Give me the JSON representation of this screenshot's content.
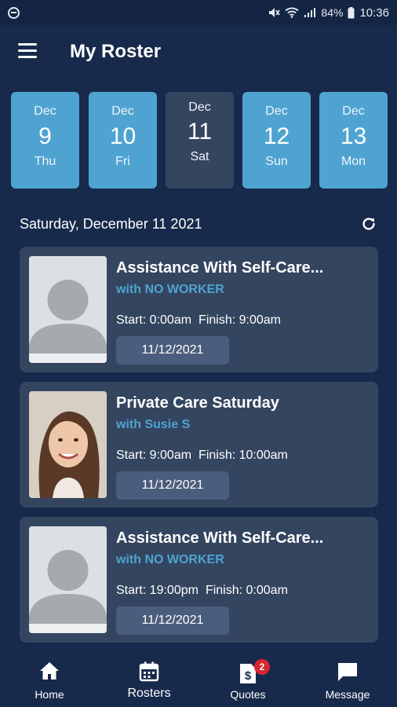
{
  "status_bar": {
    "battery": "84%",
    "time": "10:36"
  },
  "app_bar": {
    "title": "My Roster"
  },
  "dates": [
    {
      "month": "Dec",
      "day": "9",
      "weekday": "Thu",
      "selected": false
    },
    {
      "month": "Dec",
      "day": "10",
      "weekday": "Fri",
      "selected": false
    },
    {
      "month": "Dec",
      "day": "11",
      "weekday": "Sat",
      "selected": true
    },
    {
      "month": "Dec",
      "day": "12",
      "weekday": "Sun",
      "selected": false
    },
    {
      "month": "Dec",
      "day": "13",
      "weekday": "Mon",
      "selected": false
    }
  ],
  "section": {
    "date_heading": "Saturday, December 11 2021"
  },
  "shifts": [
    {
      "title": "Assistance With Self-Care...",
      "worker": "with NO WORKER",
      "start": "Start: 0:00am",
      "finish": "Finish: 9:00am",
      "date": "11/12/2021",
      "avatar": "placeholder"
    },
    {
      "title": "Private Care Saturday",
      "worker": "with Susie S",
      "start": "Start: 9:00am",
      "finish": "Finish: 10:00am",
      "date": "11/12/2021",
      "avatar": "photo"
    },
    {
      "title": "Assistance With Self-Care...",
      "worker": "with NO WORKER",
      "start": "Start: 19:00pm",
      "finish": "Finish: 0:00am",
      "date": "11/12/2021",
      "avatar": "placeholder"
    }
  ],
  "bottom_nav": {
    "home": "Home",
    "rosters": "Rosters",
    "quotes": "Quotes",
    "quotes_badge": "2",
    "message": "Message"
  },
  "colors": {
    "background": "#172a4b",
    "card": "#34455f",
    "accent": "#4fa3d1",
    "badge": "#d8262f"
  }
}
